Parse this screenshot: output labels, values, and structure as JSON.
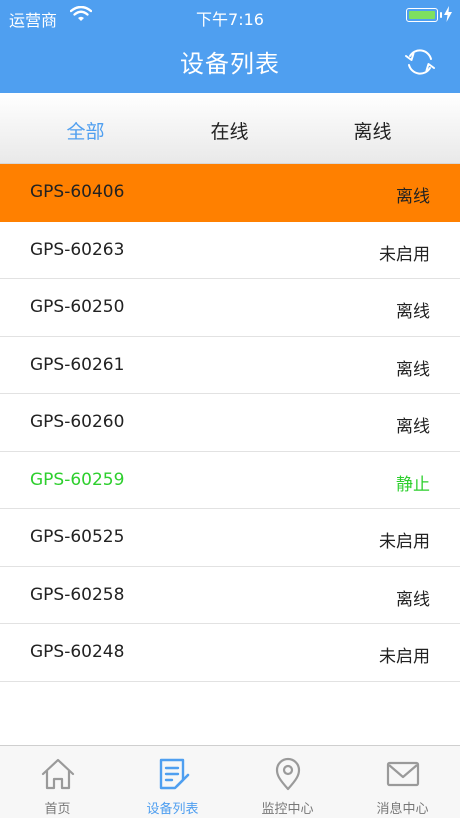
{
  "status_bar": {
    "carrier": "运营商",
    "time": "下午7:16"
  },
  "header": {
    "title": "设备列表"
  },
  "tabs": [
    {
      "label": "全部",
      "active": true
    },
    {
      "label": "在线",
      "active": false
    },
    {
      "label": "离线",
      "active": false
    }
  ],
  "devices": [
    {
      "name": "GPS-60406",
      "status": "离线"
    },
    {
      "name": "GPS-60263",
      "status": "未启用"
    },
    {
      "name": "GPS-60250",
      "status": "离线"
    },
    {
      "name": "GPS-60261",
      "status": "离线"
    },
    {
      "name": "GPS-60260",
      "status": "离线"
    },
    {
      "name": "GPS-60259",
      "status": "静止"
    },
    {
      "name": "GPS-60525",
      "status": "未启用"
    },
    {
      "name": "GPS-60258",
      "status": "离线"
    },
    {
      "name": "GPS-60248",
      "status": "未启用"
    }
  ],
  "tab_bar": [
    {
      "label": "首页",
      "icon": "home-icon"
    },
    {
      "label": "设备列表",
      "icon": "device-list-icon"
    },
    {
      "label": "监控中心",
      "icon": "location-pin-icon"
    },
    {
      "label": "消息中心",
      "icon": "envelope-icon"
    }
  ],
  "colors": {
    "header": "#4f9ff0",
    "selected_row": "#ff8000",
    "still_status": "#2ecf2e",
    "active_tab": "#4f9ff0"
  }
}
